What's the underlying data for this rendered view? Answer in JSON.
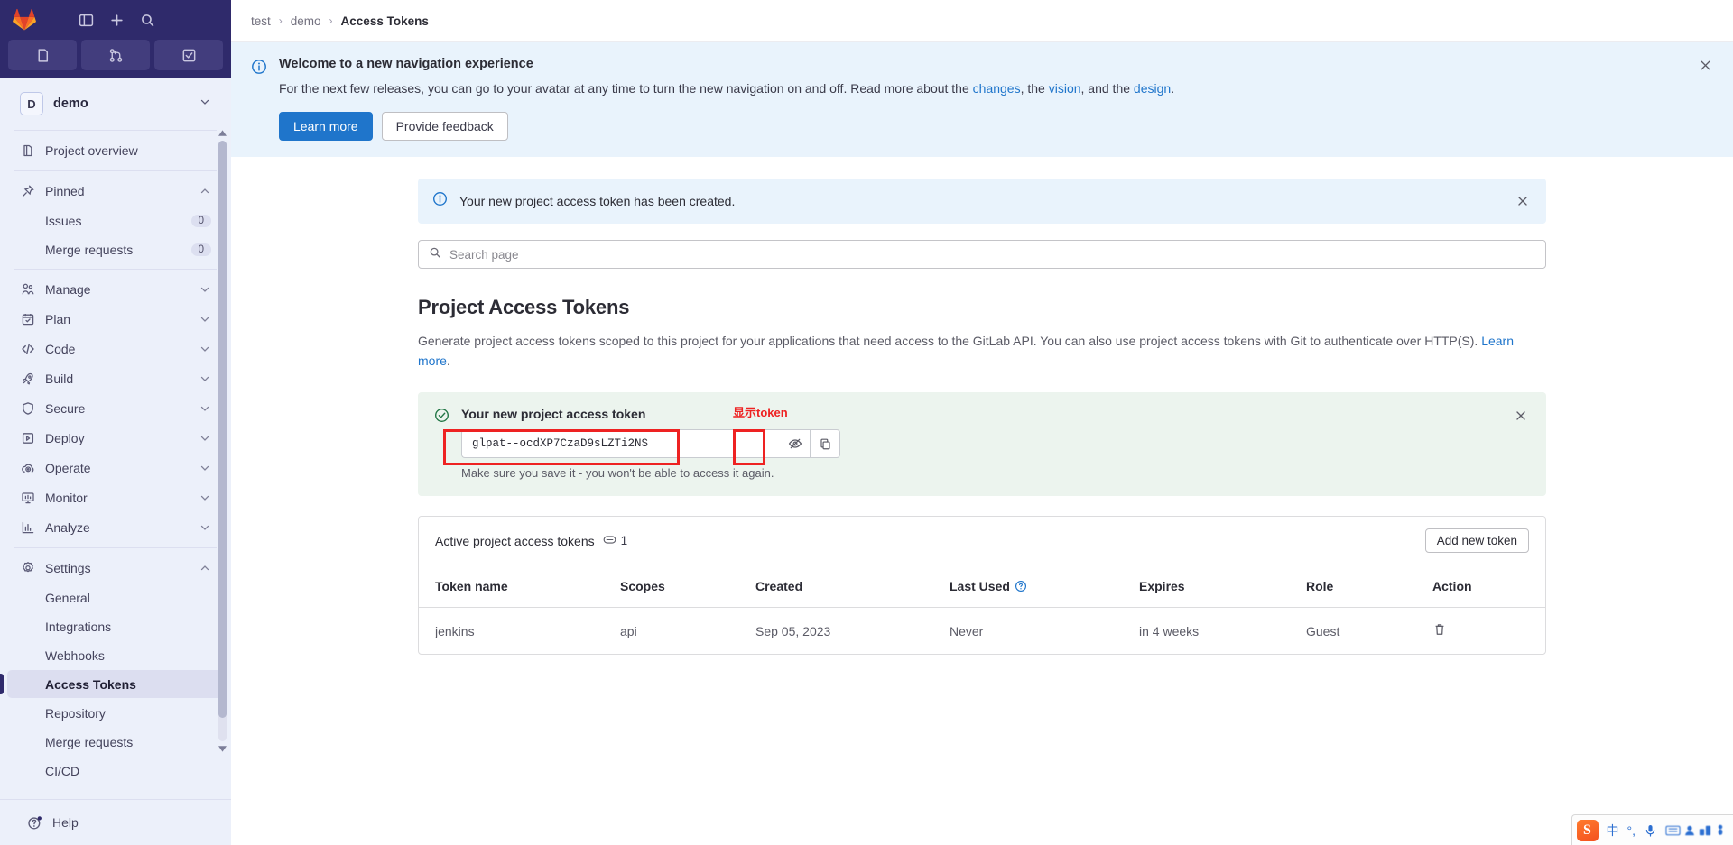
{
  "sidebar": {
    "logo": "gitlab-logo",
    "header_icons": [
      "sidebar-toggle-icon",
      "plus-icon",
      "search-icon"
    ],
    "tabs": [
      "issues-tab-icon",
      "merge-requests-tab-icon",
      "todos-tab-icon"
    ],
    "project": {
      "initial": "D",
      "name": "demo"
    },
    "items": [
      {
        "label": "Project overview",
        "icon": "project-overview-icon",
        "type": "top"
      },
      {
        "label": "Pinned",
        "icon": "pin-icon",
        "type": "section",
        "chevron": "up"
      },
      {
        "label": "Issues",
        "type": "sub",
        "badge": "0"
      },
      {
        "label": "Merge requests",
        "type": "sub",
        "badge": "0"
      },
      {
        "label": "Manage",
        "icon": "users-icon",
        "type": "section",
        "chevron": "down"
      },
      {
        "label": "Plan",
        "icon": "calendar-icon",
        "type": "section",
        "chevron": "down"
      },
      {
        "label": "Code",
        "icon": "code-icon",
        "type": "section",
        "chevron": "down"
      },
      {
        "label": "Build",
        "icon": "rocket-icon",
        "type": "section",
        "chevron": "down"
      },
      {
        "label": "Secure",
        "icon": "shield-icon",
        "type": "section",
        "chevron": "down"
      },
      {
        "label": "Deploy",
        "icon": "deploy-icon",
        "type": "section",
        "chevron": "down"
      },
      {
        "label": "Operate",
        "icon": "cloud-gear-icon",
        "type": "section",
        "chevron": "down"
      },
      {
        "label": "Monitor",
        "icon": "monitor-icon",
        "type": "section",
        "chevron": "down"
      },
      {
        "label": "Analyze",
        "icon": "chart-icon",
        "type": "section",
        "chevron": "down"
      },
      {
        "label": "Settings",
        "icon": "gear-icon",
        "type": "section",
        "chevron": "up"
      },
      {
        "label": "General",
        "type": "sub"
      },
      {
        "label": "Integrations",
        "type": "sub"
      },
      {
        "label": "Webhooks",
        "type": "sub"
      },
      {
        "label": "Access Tokens",
        "type": "sub",
        "active": true
      },
      {
        "label": "Repository",
        "type": "sub"
      },
      {
        "label": "Merge requests",
        "type": "sub"
      },
      {
        "label": "CI/CD",
        "type": "sub"
      }
    ],
    "help": {
      "label": "Help",
      "icon": "help-icon"
    }
  },
  "breadcrumb": {
    "items": [
      "test",
      "demo"
    ],
    "separator": "›",
    "current": "Access Tokens"
  },
  "nav_banner": {
    "icon": "info-circle-icon",
    "title": "Welcome to a new navigation experience",
    "body_pre": "For the next few releases, you can go to your avatar at any time to turn the new navigation on and off. Read more about the ",
    "link1": "changes",
    "body_mid1": ", the ",
    "link2": "vision",
    "body_mid2": ", and the ",
    "link3": "design",
    "body_end": ".",
    "learn_more": "Learn more",
    "provide_feedback": "Provide feedback",
    "close_icon": "close-icon"
  },
  "created_alert": {
    "icon": "info-circle-icon",
    "text": "Your new project access token has been created.",
    "close_icon": "close-icon"
  },
  "search": {
    "placeholder": "Search page",
    "value": "",
    "icon": "search-icon"
  },
  "page": {
    "title": "Project Access Tokens",
    "description_pre": "Generate project access tokens scoped to this project for your applications that need access to the GitLab API. You can also use project access tokens with Git to authenticate over HTTP(S). ",
    "description_link": "Learn more",
    "description_end": "."
  },
  "token_alert": {
    "icon": "check-circle-icon",
    "title": "Your new project access token",
    "token_value": "glpat--ocdXP7CzaD9sLZTi2NS",
    "reveal_icon": "eye-slash-icon",
    "copy_icon": "copy-icon",
    "note": "Make sure you save it - you won't be able to access it again.",
    "close_icon": "close-icon"
  },
  "annotation": {
    "label": "显示token",
    "color": "#ee2222"
  },
  "tokens_card": {
    "header_title": "Active project access tokens",
    "count_icon": "token-count-icon",
    "count": "1",
    "add_button": "Add new token",
    "columns": [
      "Token name",
      "Scopes",
      "Created",
      "Last Used",
      "Expires",
      "Role",
      "Action"
    ],
    "last_used_help_icon": "question-circle-icon",
    "rows": [
      {
        "name": "jenkins",
        "scopes": "api",
        "created": "Sep 05, 2023",
        "last_used": "Never",
        "expires": "in 4 weeks",
        "role": "Guest",
        "action_icon": "trash-icon"
      }
    ]
  },
  "ime": {
    "logo": "S",
    "lang": "中",
    "punct": "°,",
    "mic": "microphone-icon",
    "keyboard": "keyboard-icon",
    "extras": "toolbar-icons"
  },
  "colors": {
    "brand_navy": "#2f2a6b",
    "accent_blue": "#1f75cb",
    "info_bg": "#e9f3fc",
    "success_bg": "#ecf4ee",
    "annotation_red": "#ee2222",
    "sidebar_bg": "#ecf0fa"
  }
}
